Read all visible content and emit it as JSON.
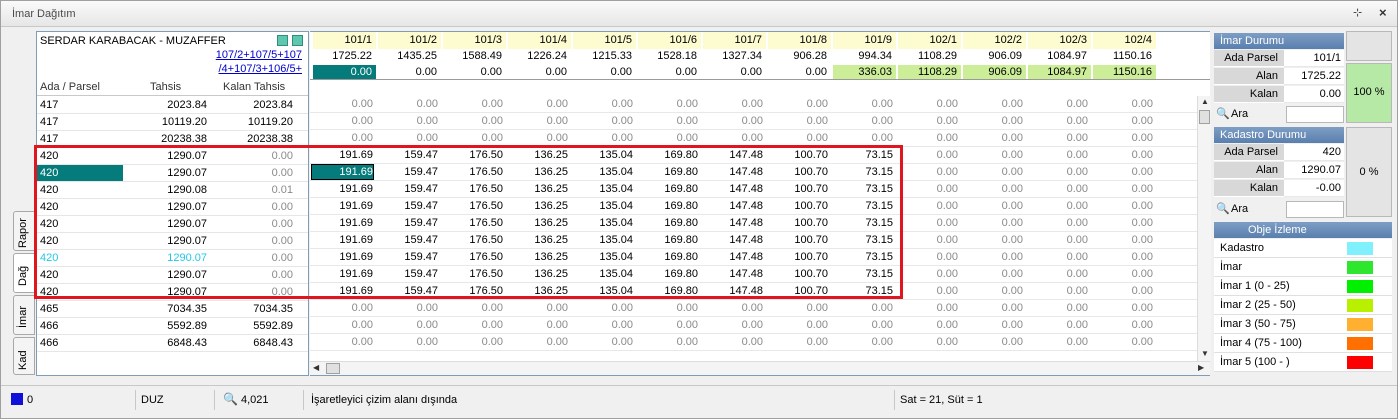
{
  "window": {
    "title": "İmar Dağıtım",
    "pin": "⊹",
    "close": "×"
  },
  "tabs": [
    "Rapor",
    "Dağ",
    "İmar",
    "Kad"
  ],
  "owner": {
    "name": "SERDAR KARABACAK - MUZAFFER",
    "link1": "107/2+107/5+107",
    "link2": "/4+107/3+106/5+"
  },
  "left_header": {
    "col1": "Ada / Parsel",
    "col2": "Tahsis",
    "col3": "Kalan Tahsis"
  },
  "left_rows": [
    {
      "ap": "417",
      "tahsis": "2023.84",
      "kalan": "2023.84"
    },
    {
      "ap": "417",
      "tahsis": "10119.20",
      "kalan": "10119.20"
    },
    {
      "ap": "417",
      "tahsis": "20238.38",
      "kalan": "20238.38"
    },
    {
      "ap": "420",
      "tahsis": "1290.07",
      "kalan": "0.00"
    },
    {
      "ap": "420",
      "tahsis": "1290.07",
      "kalan": "0.00"
    },
    {
      "ap": "420",
      "tahsis": "1290.08",
      "kalan": "0.01"
    },
    {
      "ap": "420",
      "tahsis": "1290.07",
      "kalan": "0.00"
    },
    {
      "ap": "420",
      "tahsis": "1290.07",
      "kalan": "0.00"
    },
    {
      "ap": "420",
      "tahsis": "1290.07",
      "kalan": "0.00"
    },
    {
      "ap": "420",
      "tahsis": "1290.07",
      "kalan": "0.00"
    },
    {
      "ap": "420",
      "tahsis": "1290.07",
      "kalan": "0.00"
    },
    {
      "ap": "420",
      "tahsis": "1290.07",
      "kalan": "0.00"
    },
    {
      "ap": "465",
      "tahsis": "7034.35",
      "kalan": "7034.35"
    },
    {
      "ap": "466",
      "tahsis": "5592.89",
      "kalan": "5592.89"
    },
    {
      "ap": "466",
      "tahsis": "6848.43",
      "kalan": "6848.43"
    }
  ],
  "grid_columns": [
    "101/1",
    "101/2",
    "101/3",
    "101/4",
    "101/5",
    "101/6",
    "101/7",
    "101/8",
    "101/9",
    "102/1",
    "102/2",
    "102/3",
    "102/4"
  ],
  "grid_areas": [
    "1725.22",
    "1435.25",
    "1588.49",
    "1226.24",
    "1215.33",
    "1528.18",
    "1327.34",
    "906.28",
    "994.34",
    "1108.29",
    "906.09",
    "1084.97",
    "1150.16"
  ],
  "grid_remain": [
    "0.00",
    "0.00",
    "0.00",
    "0.00",
    "0.00",
    "0.00",
    "0.00",
    "0.00",
    "336.03",
    "1108.29",
    "906.09",
    "1084.97",
    "1150.16"
  ],
  "grid_row_zero": "0.00",
  "grid_row_active": [
    "191.69",
    "159.47",
    "176.50",
    "136.25",
    "135.04",
    "169.80",
    "147.48",
    "100.70",
    "73.15",
    "0.00",
    "0.00",
    "0.00",
    "0.00"
  ],
  "imar_durumu": {
    "title": "İmar Durumu",
    "ada_parsel_lbl": "Ada Parsel",
    "ada_parsel": "101/1",
    "alan_lbl": "Alan",
    "alan": "1725.22",
    "kalan_lbl": "Kalan",
    "kalan": "0.00",
    "pct": "100 %",
    "ara": "Ara"
  },
  "kadastro_durumu": {
    "title": "Kadastro  Durumu",
    "ada_parsel_lbl": "Ada Parsel",
    "ada_parsel": "420",
    "alan_lbl": "Alan",
    "alan": "1290.07",
    "kalan_lbl": "Kalan",
    "kalan": "-0.00",
    "pct": "0 %",
    "ara": "Ara"
  },
  "obje_izleme": {
    "title": "Obje İzleme",
    "items": [
      {
        "label": "Kadastro",
        "color": "#80f0ff"
      },
      {
        "label": "İmar",
        "color": "#2ee62e"
      },
      {
        "label": "İmar 1 (0 - 25)",
        "color": "#00f000"
      },
      {
        "label": "İmar 2 (25 - 50)",
        "color": "#b8f000"
      },
      {
        "label": "İmar 3 (50 - 75)",
        "color": "#ffb030"
      },
      {
        "label": "İmar 4 (75 - 100)",
        "color": "#ff7000"
      },
      {
        "label": "İmar 5 (100 - )",
        "color": "#ff0000"
      }
    ]
  },
  "status": {
    "left_value": "0",
    "mode": "DUZ",
    "zoom": "4,021",
    "message": "İşaretleyici çizim alanı dışında",
    "position": "Sat = 21, Süt = 1"
  },
  "colors": {
    "accent": "#067b7b",
    "highlight": "#e0161e",
    "green_cell": "#ccee99",
    "cyan_text": "#22c8e8"
  }
}
